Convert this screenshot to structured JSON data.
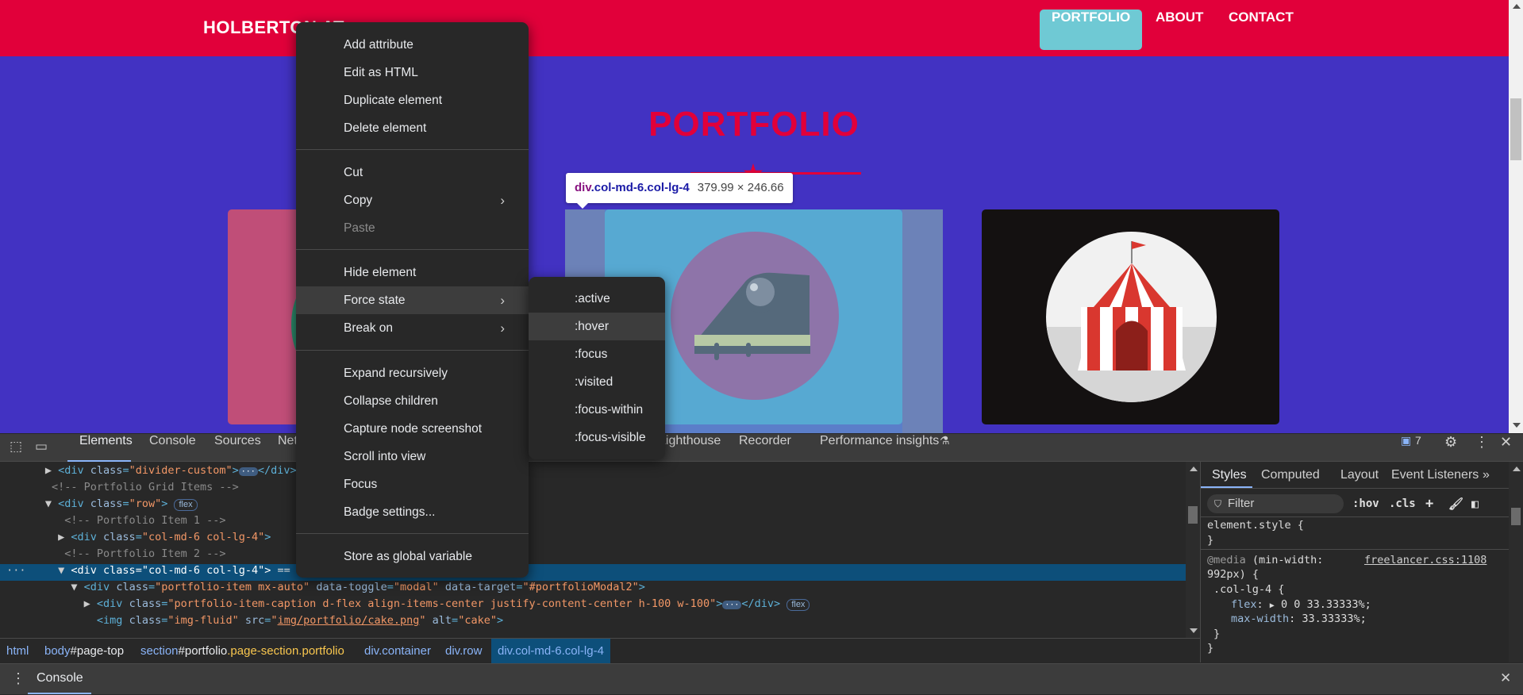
{
  "site": {
    "brand": "HOLBERTON AT",
    "nav": [
      "PORTFOLIO",
      "ABOUT",
      "CONTACT"
    ],
    "heading": "PORTFOLIO"
  },
  "tooltip": {
    "tag": "div",
    "classes": ".col-md-6.col-lg-4",
    "size": "379.99 × 246.66"
  },
  "context_menu": {
    "items": [
      "Add attribute",
      "Edit as HTML",
      "Duplicate element",
      "Delete element",
      "Cut",
      "Copy",
      "Paste",
      "Hide element",
      "Force state",
      "Break on",
      "Expand recursively",
      "Collapse children",
      "Capture node screenshot",
      "Scroll into view",
      "Focus",
      "Badge settings...",
      "Store as global variable"
    ],
    "submenu": [
      ":active",
      ":hover",
      ":focus",
      ":visited",
      ":focus-within",
      ":focus-visible"
    ]
  },
  "devtools": {
    "tabs": [
      "Elements",
      "Console",
      "Sources",
      "Net",
      "Lighthouse",
      "Recorder",
      "Performance insights"
    ],
    "issues_count": "7",
    "dom": {
      "l1_tag": "<div ",
      "l1_attr": "class",
      "l1_val": "\"divider-custom\"",
      "l1_end": "</div>",
      "l2": "<!-- Portfolio Grid Items -->",
      "l3_val": "\"row\"",
      "l3_badge": "flex",
      "l4": "<!-- Portfolio Item 1 -->",
      "l5_val": "\"col-md-6 col-lg-4\"",
      "l6": "<!-- Portfolio Item 2 -->",
      "l7_val": "\"col-md-6 col-lg-4\"",
      "l7_tail": " == $0",
      "l8_val1": "\"portfolio-item mx-auto\"",
      "l8_attr2": "data-toggle",
      "l8_val2": "\"modal\"",
      "l8_attr3": "data-target",
      "l8_val3": "\"#portfolioModal2\"",
      "l9_val": "\"portfolio-item-caption d-flex align-items-center justify-content-center h-100 w-100\"",
      "l9_badge": "flex",
      "l10_val1": "\"img-fluid\"",
      "l10_attr2": "src",
      "l10_val2": "img/portfolio/cake.png",
      "l10_attr3": "alt",
      "l10_val3": "\"cake\""
    },
    "breadcrumbs": {
      "c1": "html",
      "c2": "body",
      "c2b": "#page-top",
      "c3": "section",
      "c3b": "#portfolio",
      "c3c": ".page-section.portfolio",
      "c4": "div",
      "c4b": ".container",
      "c5": "div",
      "c5b": ".row",
      "c6": "div.col-md-6.col-lg-4"
    },
    "styles_tabs": [
      "Styles",
      "Computed",
      "Layout",
      "Event Listeners"
    ],
    "filter_placeholder": "Filter",
    "hov": ":hov",
    "cls": ".cls",
    "styles": {
      "element_style": "element.style {",
      "close1": "}",
      "media_at": "@media",
      "media_q": "(min-width:",
      "media_q2": "992px) {",
      "source": "freelancer.css:1108",
      "selector": ".col-lg-4 {",
      "p1_name": "flex",
      "p1_val": "0 0 33.33333%;",
      "p2_name": "max-width",
      "p2_val": "33.33333%;",
      "close2": "}",
      "close3": "}"
    },
    "drawer_tab": "Console"
  }
}
